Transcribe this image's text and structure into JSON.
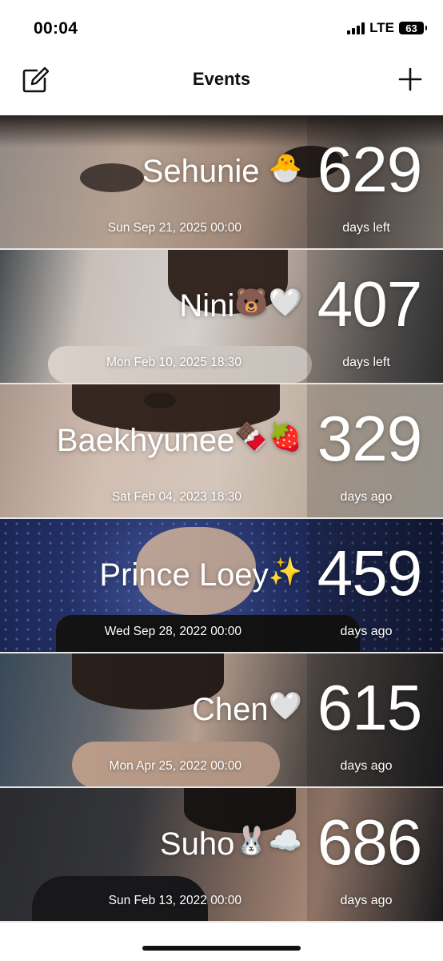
{
  "status_bar": {
    "time": "00:04",
    "network": "LTE",
    "battery": "63"
  },
  "nav": {
    "title": "Events",
    "edit_icon": "edit-icon",
    "add_icon": "plus-icon"
  },
  "events": [
    {
      "name": "Sehunie",
      "emoji": "🐣",
      "date": "Sun Sep 21, 2025 00:00",
      "count": "629",
      "label": "days left"
    },
    {
      "name": "Nini",
      "emoji": "🐻🤍",
      "date": "Mon Feb 10, 2025 18:30",
      "count": "407",
      "label": "days left"
    },
    {
      "name": "Baekhyunee",
      "emoji": "🍫🍓",
      "date": "Sat Feb 04, 2023 18:30",
      "count": "329",
      "label": "days ago"
    },
    {
      "name": "Prince Loey",
      "emoji": "✨",
      "date": "Wed Sep 28, 2022 00:00",
      "count": "459",
      "label": "days ago"
    },
    {
      "name": "Chen",
      "emoji": "🤍",
      "date": "Mon Apr 25, 2022 00:00",
      "count": "615",
      "label": "days ago"
    },
    {
      "name": "Suho",
      "emoji": "🐰☁️",
      "date": "Sun Feb 13, 2022 00:00",
      "count": "686",
      "label": "days ago"
    }
  ]
}
